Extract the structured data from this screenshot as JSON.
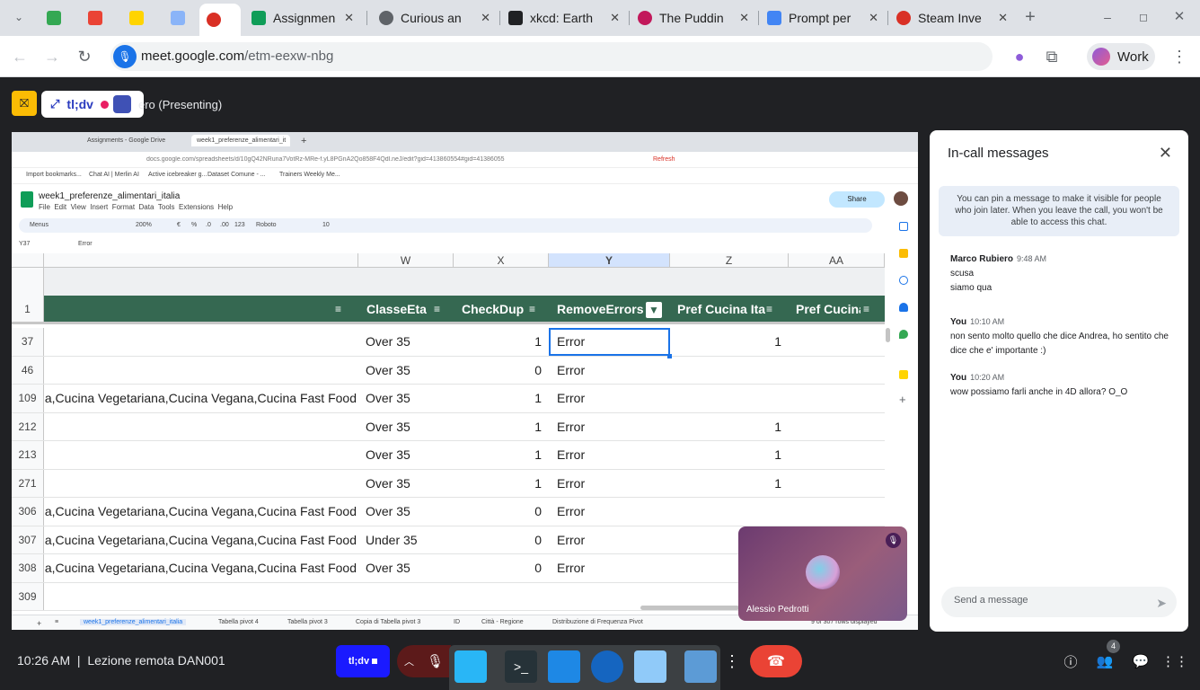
{
  "browser": {
    "tabs": [
      {
        "title": "",
        "color": "#34a853"
      },
      {
        "title": "",
        "color": "#ea4335"
      },
      {
        "title": "",
        "color": "#ffd400"
      },
      {
        "title": "",
        "color": "#8ab4f8"
      },
      {
        "title": "",
        "color": "#d93025"
      },
      {
        "title": "Assignmen",
        "color": "#0f9d58"
      },
      {
        "title": "Curious an",
        "color": "#5f6368"
      },
      {
        "title": "xkcd: Earth",
        "color": "#202124"
      },
      {
        "title": "The Puddin",
        "color": "#c2185b"
      },
      {
        "title": "Prompt per",
        "color": "#4285f4"
      },
      {
        "title": "Steam Inve",
        "color": "#d93025"
      }
    ],
    "url_domain": "meet.google.com",
    "url_path": "/etm-eexw-nbg",
    "profile_label": "Work"
  },
  "meet": {
    "presenting_label": "ero (Presenting)",
    "tldv_label": "tl;dv",
    "clock": "10:26 AM",
    "meeting_name": "Lezione remota DAN001",
    "participants_count": "4",
    "tldv_record_label": "tl;dv"
  },
  "shared_screen": {
    "inner_tabs": [
      "Assignments - Google Drive",
      "week1_preferenze_alimentari_it"
    ],
    "inner_url": "docs.google.com/spreadsheets/d/10gQ42NRuna7VotRz-MRe-f.yL8PGnA2Qo858F4Qdl.neJ/edit?gid=413860554#gid=41386055",
    "refresh_label": "Refresh",
    "bookmarks": [
      "Import bookmarks...",
      "Chat AI | Merlin AI",
      "Active icebreaker g...",
      "Dataset Comune - ...",
      "Trainers Weekly Me..."
    ],
    "doc_title": "week1_preferenze_alimentari_italia",
    "menu": [
      "File",
      "Edit",
      "View",
      "Insert",
      "Format",
      "Data",
      "Tools",
      "Extensions",
      "Help"
    ],
    "share_label": "Share",
    "toolbar": {
      "menus": "Menus",
      "zoom": "200%",
      "font": "Roboto",
      "font_size": "10",
      "currency": "€",
      "percent": "%",
      "dec_less": ".0",
      "dec_more": ".00",
      "number_format": "123"
    },
    "cell_ref": "Y37",
    "formula": "Error",
    "columns": [
      "W",
      "X",
      "Y",
      "Z",
      "AA"
    ],
    "header_row_num": "1",
    "headers": [
      "ClasseEta",
      "CheckDup",
      "RemoveErrors",
      "Pref Cucina Ita",
      "Pref Cucina"
    ],
    "rows": [
      {
        "num": "37",
        "v": "",
        "w": "Over 35",
        "x": "1",
        "y": "Error",
        "z": "1"
      },
      {
        "num": "46",
        "v": "",
        "w": "Over 35",
        "x": "0",
        "y": "Error",
        "z": ""
      },
      {
        "num": "109",
        "v": "na,Cucina Vegetariana,Cucina Vegana,Cucina Fast Food",
        "w": "Over 35",
        "x": "1",
        "y": "Error",
        "z": ""
      },
      {
        "num": "212",
        "v": "",
        "w": "Over 35",
        "x": "1",
        "y": "Error",
        "z": "1"
      },
      {
        "num": "213",
        "v": "",
        "w": "Over 35",
        "x": "1",
        "y": "Error",
        "z": "1"
      },
      {
        "num": "271",
        "v": "",
        "w": "Over 35",
        "x": "1",
        "y": "Error",
        "z": "1"
      },
      {
        "num": "306",
        "v": "na,Cucina Vegetariana,Cucina Vegana,Cucina Fast Food",
        "w": "Over 35",
        "x": "0",
        "y": "Error",
        "z": ""
      },
      {
        "num": "307",
        "v": "na,Cucina Vegetariana,Cucina Vegana,Cucina Fast Food",
        "w": "Under 35",
        "x": "0",
        "y": "Error",
        "z": ""
      },
      {
        "num": "308",
        "v": "na,Cucina Vegetariana,Cucina Vegana,Cucina Fast Food",
        "w": "Over 35",
        "x": "0",
        "y": "Error",
        "z": ""
      },
      {
        "num": "309",
        "v": "",
        "w": "",
        "x": "",
        "y": "",
        "z": ""
      }
    ],
    "sheet_tabs": [
      "week1_preferenze_alimentari_italia",
      "Tabella pivot 4",
      "Tabella pivot 3",
      "Copia di Tabella pivot 3",
      "ID",
      "Città - Regione",
      "Distribuzione di Frequenza Pivot"
    ],
    "rows_status": "9 of 307 rows displayed"
  },
  "chat": {
    "title": "In-call messages",
    "pin_note": "You can pin a message to make it visible for people who join later. When you leave the call, you won't be able to access this chat.",
    "messages": [
      {
        "author": "Marco Rubiero",
        "time": "9:48 AM",
        "lines": [
          "scusa",
          "siamo qua"
        ]
      },
      {
        "author": "You",
        "time": "10:10 AM",
        "lines": [
          "non sento molto quello che dice Andrea, ho sentito che dice che e' importante :)"
        ]
      },
      {
        "author": "You",
        "time": "10:20 AM",
        "lines": [
          "wow possiamo farli anche in 4D allora? O_O"
        ]
      }
    ],
    "input_placeholder": "Send a message"
  },
  "video_tile": {
    "name": "Alessio Pedrotti"
  },
  "colors": {
    "accent_green": "#0f9d58",
    "end_call": "#ea4335",
    "tldv_blue": "#1a1aff",
    "meet_bg": "#202124"
  }
}
